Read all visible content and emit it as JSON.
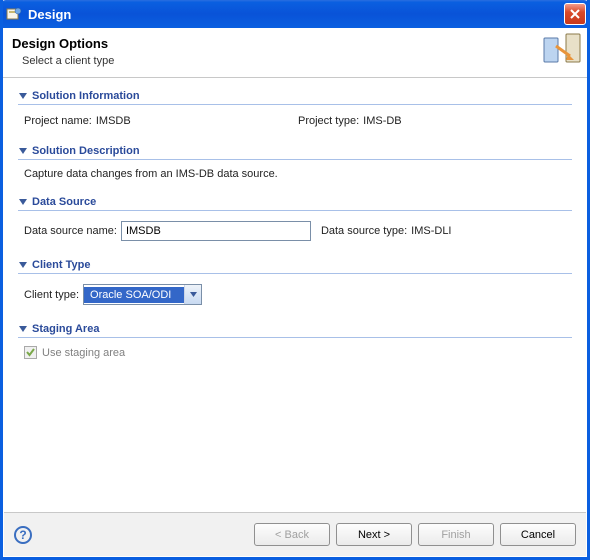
{
  "window": {
    "title": "Design"
  },
  "header": {
    "title": "Design Options",
    "subtitle": "Select a client type"
  },
  "sections": {
    "solution_info": {
      "title": "Solution Information",
      "project_name_label": "Project name:",
      "project_name": "IMSDB",
      "project_type_label": "Project type:",
      "project_type": "IMS-DB"
    },
    "solution_desc": {
      "title": "Solution Description",
      "text": "Capture data changes from an IMS-DB data source."
    },
    "data_source": {
      "title": "Data Source",
      "name_label": "Data source name:",
      "name": "IMSDB",
      "type_label": "Data source type:",
      "type": "IMS-DLI"
    },
    "client_type": {
      "title": "Client Type",
      "label": "Client type:",
      "selected": "Oracle SOA/ODI"
    },
    "staging": {
      "title": "Staging Area",
      "checkbox_label": "Use staging area",
      "checked": true,
      "disabled": true
    }
  },
  "buttons": {
    "back": "< Back",
    "next": "Next >",
    "finish": "Finish",
    "cancel": "Cancel"
  }
}
